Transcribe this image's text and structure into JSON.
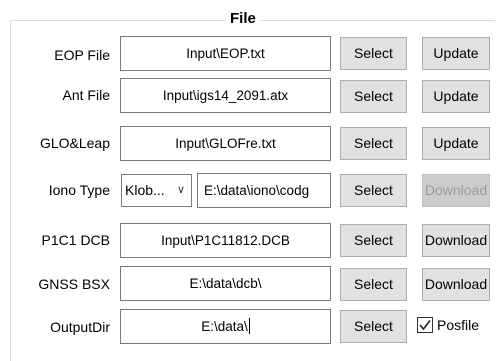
{
  "group": {
    "title": "File"
  },
  "rows": {
    "eop": {
      "label": "EOP File",
      "value": "Input\\EOP.txt",
      "select": "Select",
      "action": "Update"
    },
    "ant": {
      "label": "Ant File",
      "value": "Input\\igs14_2091.atx",
      "select": "Select",
      "action": "Update"
    },
    "glo": {
      "label": "GLO&Leap",
      "value": "Input\\GLOFre.txt",
      "select": "Select",
      "action": "Update"
    },
    "iono": {
      "label": "Iono Type",
      "combo": "Klob...",
      "value": "E:\\data\\iono\\codg",
      "select": "Select",
      "action": "Download",
      "action_disabled": true
    },
    "p1c1": {
      "label": "P1C1 DCB",
      "value": "Input\\P1C11812.DCB",
      "select": "Select",
      "action": "Download"
    },
    "gnss": {
      "label": "GNSS BSX",
      "value": "E:\\data\\dcb\\",
      "select": "Select",
      "action": "Download"
    },
    "out": {
      "label": "OutputDir",
      "value": "E:\\data\\",
      "select": "Select",
      "checkbox_label": "Posfile",
      "checkbox_checked": true
    }
  },
  "icons": {
    "combo_arrow": "chevron-down-icon",
    "checkbox": "checkmark-icon"
  }
}
